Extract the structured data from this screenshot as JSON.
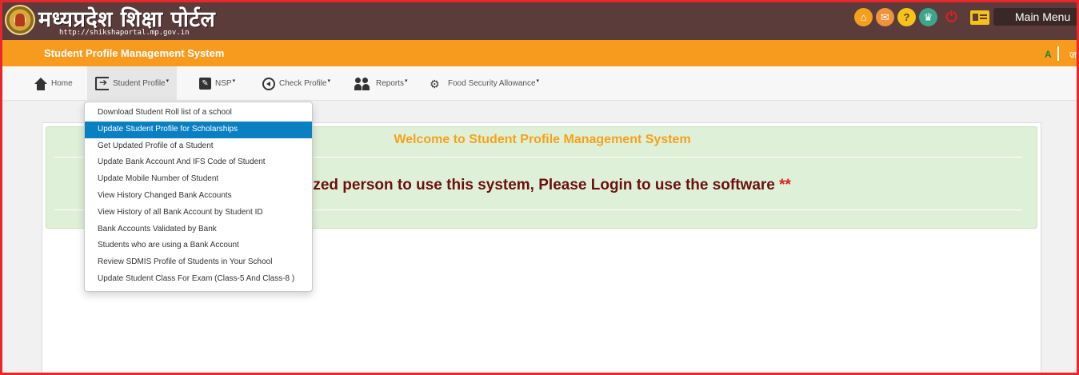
{
  "header": {
    "logo_title": "मध्यप्रदेश शिक्षा पोर्टल",
    "logo_url": "http://shikshaportal.mp.gov.in",
    "icons": [
      "home-icon",
      "mail-icon",
      "help-icon",
      "trophy-icon",
      "power-icon",
      "id-card-icon"
    ],
    "main_menu_label": "Main Menu"
  },
  "orange_bar": {
    "title": "Student Profile Management System",
    "font_size_label": "A",
    "lang_label": "ज"
  },
  "nav": {
    "home": "Home",
    "student_profile": "Student Profile",
    "nsp": "NSP",
    "check_profile": "Check Profile",
    "reports": "Reports",
    "food_security": "Food Security Allowance",
    "caret": "▾"
  },
  "dropdown": {
    "items": [
      "Download Student Roll list of a school",
      "Update Student Profile for Scholarships",
      "Get Updated Profile of a Student",
      "Update Bank Account And IFS Code of Student",
      "Update Mobile Number of Student",
      "View History Changed Bank Accounts",
      "View History of all Bank Account by Student ID",
      "Bank Accounts Validated by Bank",
      "Students who are using a Bank Account",
      "Review SDMIS Profile of Students in Your School",
      "Update Student Class For Exam (Class-5 And Class-8 )"
    ],
    "selected_index": 1
  },
  "main": {
    "welcome": "Welcome to Student Profile Management System",
    "login_message": "orized person to use this system, Please Login to use the software",
    "login_stars": "**"
  },
  "colors": {
    "header_bg": "#5c3b3b",
    "orange": "#f79b1e",
    "selected_bg": "#0a7fc2",
    "welcome_text": "#f5a21a",
    "login_text": "#6b0f0f"
  }
}
